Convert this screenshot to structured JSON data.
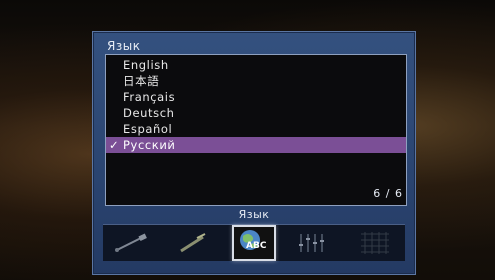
{
  "panel": {
    "title": "Язык",
    "page_indicator": "6 / 6",
    "section_label": "Язык"
  },
  "languages": [
    {
      "label": "English",
      "selected": false
    },
    {
      "label": "日本語",
      "selected": false
    },
    {
      "label": "Français",
      "selected": false
    },
    {
      "label": "Deutsch",
      "selected": false
    },
    {
      "label": "Español",
      "selected": false
    },
    {
      "label": "Русский",
      "selected": true,
      "check": "✓"
    }
  ],
  "icons": [
    {
      "name": "speaker-cable-icon",
      "active": false
    },
    {
      "name": "tool-icon",
      "active": false
    },
    {
      "name": "language-globe-icon",
      "active": true,
      "text": "ABC"
    },
    {
      "name": "equalizer-icon",
      "active": false
    },
    {
      "name": "grid-icon",
      "active": false
    }
  ],
  "colors": {
    "panel": "#2a4470",
    "selection": "#7b4f96",
    "list_background": "#0b0b0d"
  }
}
